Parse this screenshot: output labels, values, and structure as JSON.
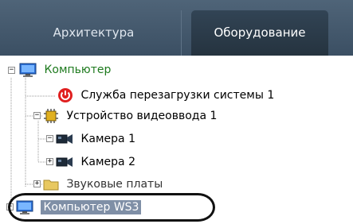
{
  "tabs": [
    {
      "label": "Архитектура",
      "active": false
    },
    {
      "label": "Оборудование",
      "active": true
    }
  ],
  "tree": {
    "items": [
      {
        "label": "Компьютер",
        "icon": "monitor-icon",
        "expander": "−"
      },
      {
        "label": "Служба перезагрузки системы 1",
        "icon": "power-icon"
      },
      {
        "label": "Устройство видеоввода 1",
        "icon": "chip-icon",
        "expander": "−"
      },
      {
        "label": "Камера 1",
        "icon": "camera-icon",
        "expander": "−"
      },
      {
        "label": "Камера 2",
        "icon": "camera-icon",
        "expander": "+"
      },
      {
        "label": "Звуковые платы",
        "icon": "folder-icon",
        "expander": "+"
      },
      {
        "label": "Компьютер WS3",
        "icon": "monitor-icon",
        "expander": "+",
        "selected": true
      }
    ]
  },
  "colors": {
    "tabbar": "#3b4f63",
    "active_tab": "#25333f",
    "computer_label": "#1e7a1e",
    "selection": "#7f8fa6",
    "power": "#e02020"
  }
}
